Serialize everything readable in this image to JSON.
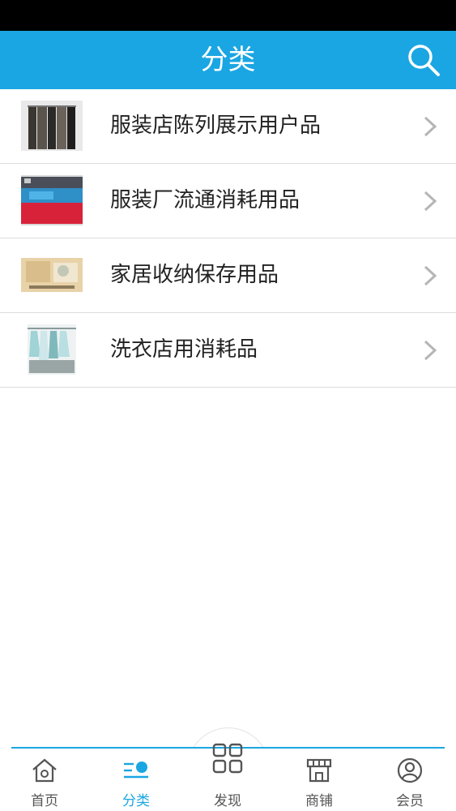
{
  "header": {
    "title": "分类"
  },
  "categories": [
    {
      "label": "服装店陈列展示用户品",
      "thumb": "clothing-rack"
    },
    {
      "label": "服装厂流通消耗用品",
      "thumb": "folded-garments"
    },
    {
      "label": "家居收纳保存用品",
      "thumb": "storage-box"
    },
    {
      "label": "洗衣店用消耗品",
      "thumb": "laundry-hangers"
    }
  ],
  "tabbar": {
    "items": [
      {
        "label": "首页",
        "icon": "home-icon"
      },
      {
        "label": "分类",
        "icon": "category-icon",
        "active": true
      },
      {
        "label": "发现",
        "icon": "grid-icon"
      },
      {
        "label": "商铺",
        "icon": "shop-icon"
      },
      {
        "label": "会员",
        "icon": "user-icon"
      }
    ]
  },
  "colors": {
    "accent": "#1aa6e2",
    "text": "#222222",
    "divider": "#dcdcdc"
  }
}
